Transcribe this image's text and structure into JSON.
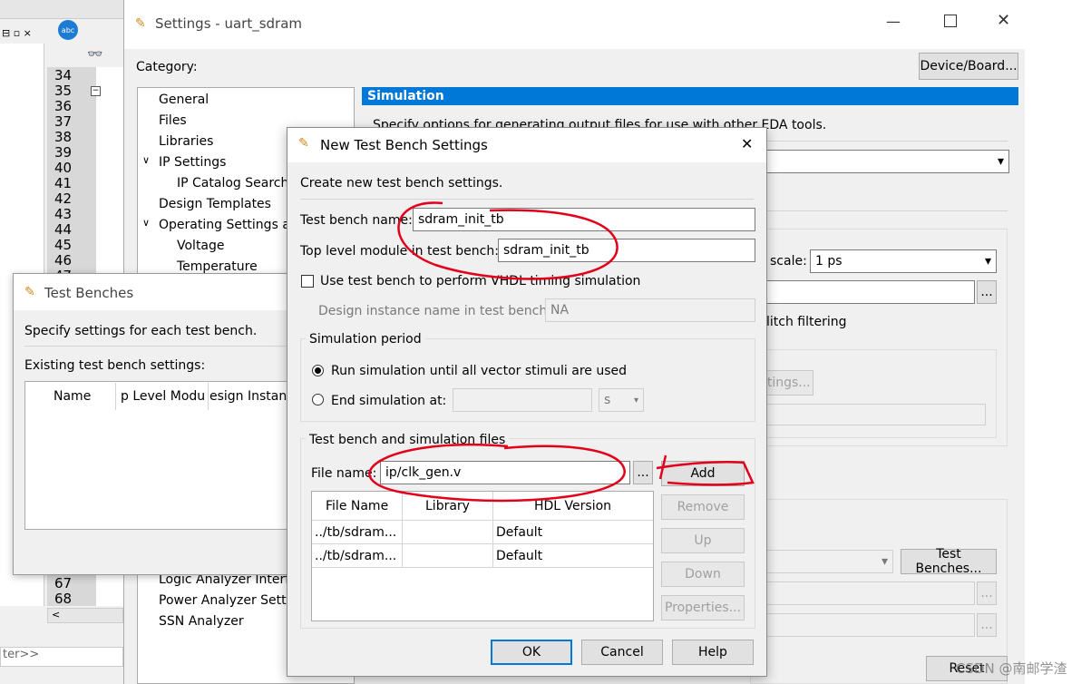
{
  "settings_window": {
    "title": "Settings - uart_sdram",
    "category_label": "Category:",
    "device_board_button": "Device/Board...",
    "categories": [
      "General",
      "Files",
      "Libraries",
      "IP Settings",
      "IP Catalog Search",
      "Design Templates",
      "Operating Settings ar",
      "Voltage",
      "Temperature",
      "Logic Analyzer Interf",
      "Power Analyzer Setti",
      "SSN Analyzer"
    ],
    "panel_title": "Simulation",
    "panel_desc": "Specify options for generating output files for use with other EDA tools.",
    "time_scale_label": "scale:",
    "time_scale_value": "1 ps",
    "glitch_label": "litch filtering",
    "settings_button": "ttings...",
    "test_benches_button": "Test Benches...",
    "reset_button": "Reset"
  },
  "editor": {
    "line_numbers": [
      "34",
      "35",
      "36",
      "37",
      "38",
      "39",
      "40",
      "41",
      "42",
      "43",
      "44",
      "45",
      "46",
      "47",
      "67",
      "68"
    ],
    "filter_text": "ter>>"
  },
  "test_benches_window": {
    "title": "Test Benches",
    "desc": "Specify settings for each test bench.",
    "existing_label": "Existing test bench settings:",
    "columns": [
      "Name",
      "p Level Modu",
      "esign Instan"
    ]
  },
  "dialog": {
    "title": "New Test Bench Settings",
    "subtitle": "Create new test bench settings.",
    "tb_name_label": "Test bench name:",
    "tb_name_value": "sdram_init_tb",
    "top_module_label": "Top level module in test bench:",
    "top_module_value": "sdram_init_tb",
    "use_vhdl_label": "Use test bench to perform VHDL timing simulation",
    "design_instance_label": "Design instance name in test bench:",
    "design_instance_value": "NA",
    "sim_period_label": "Simulation period",
    "run_all_label": "Run simulation until all vector stimuli are used",
    "end_sim_label": "End simulation at:",
    "end_unit": "s",
    "files_group_label": "Test bench and simulation files",
    "file_name_label": "File name:",
    "file_name_value": "ip/clk_gen.v",
    "browse": "...",
    "add_button": "Add",
    "remove_button": "Remove",
    "up_button": "Up",
    "down_button": "Down",
    "properties_button": "Properties...",
    "table_headers": [
      "File Name",
      "Library",
      "HDL Version"
    ],
    "rows": [
      {
        "file": "../tb/sdram...",
        "library": "",
        "hdl": "Default"
      },
      {
        "file": "../tb/sdram...",
        "library": "",
        "hdl": "Default"
      }
    ],
    "ok_button": "OK",
    "cancel_button": "Cancel",
    "help_button": "Help"
  },
  "watermark": "CSDN @南邮学渣",
  "colors": {
    "selection_blue": "#0078d7",
    "annotation_red": "#e3001b"
  }
}
